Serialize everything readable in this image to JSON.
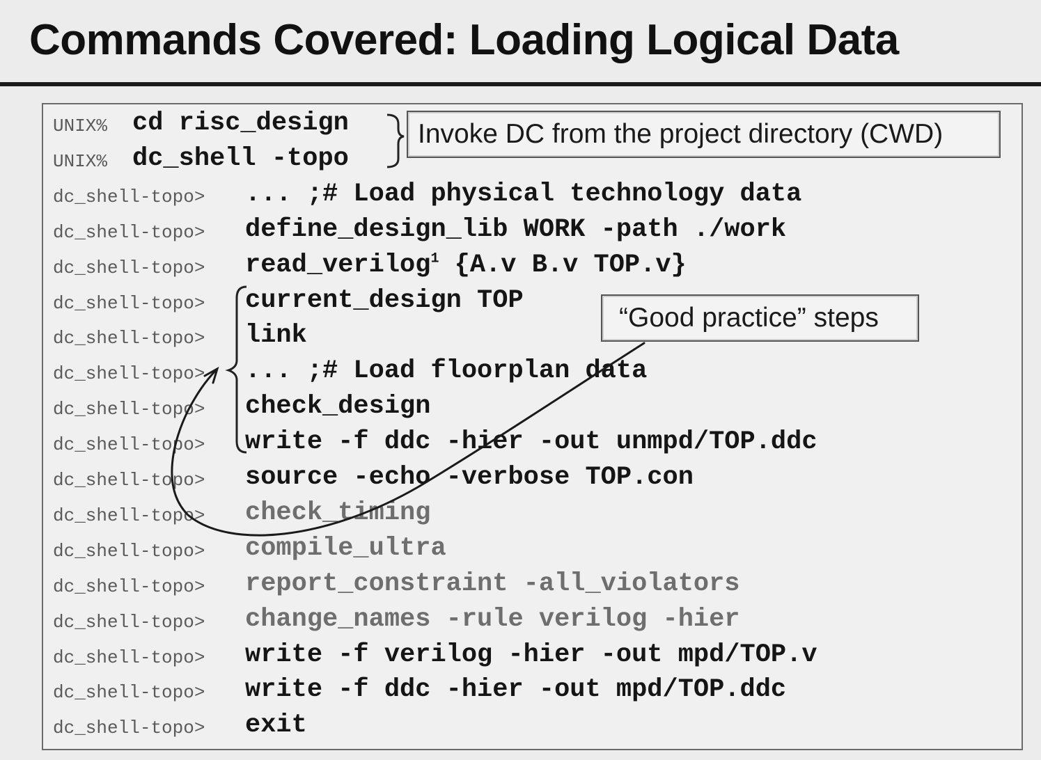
{
  "title": "Commands Covered: Loading Logical Data",
  "callouts": {
    "invoke": "Invoke DC from the project directory (CWD)",
    "good_practice": "“Good practice” steps"
  },
  "lines": [
    {
      "prompt": "UNIX%",
      "command": "cd risc_design",
      "style": "bold"
    },
    {
      "prompt": "UNIX%",
      "command": "dc_shell -topo",
      "style": "bold"
    },
    {
      "prompt": "dc_shell-topo>",
      "command": "... ;# Load physical technology data",
      "style": "bold"
    },
    {
      "prompt": "dc_shell-topo>",
      "command": "define_design_lib WORK -path ./work",
      "style": "bold"
    },
    {
      "prompt": "dc_shell-topo>",
      "command": "read_verilog",
      "superscript": "1",
      "command_tail": " {A.v B.v TOP.v}",
      "style": "bold"
    },
    {
      "prompt": "dc_shell-topo>",
      "command": "current_design TOP",
      "style": "bold"
    },
    {
      "prompt": "dc_shell-topo>",
      "command": "link",
      "style": "bold"
    },
    {
      "prompt": "dc_shell-topo>",
      "command": "... ;# Load floorplan data",
      "style": "bold"
    },
    {
      "prompt": "dc_shell-topo>",
      "command": "check_design",
      "style": "bold"
    },
    {
      "prompt": "dc_shell-topo>",
      "command": "write -f ddc -hier -out unmpd/TOP.ddc",
      "style": "bold"
    },
    {
      "prompt": "dc_shell-topo>",
      "command": "source -echo -verbose TOP.con",
      "style": "bold"
    },
    {
      "prompt": "dc_shell-topo>",
      "command": "check_timing",
      "style": "dim"
    },
    {
      "prompt": "dc_shell-topo>",
      "command": "compile_ultra",
      "style": "dim"
    },
    {
      "prompt": "dc_shell-topo>",
      "command": "report_constraint -all_violators",
      "style": "dim"
    },
    {
      "prompt": "dc_shell-topo>",
      "command": "change_names -rule verilog -hier",
      "style": "dim"
    },
    {
      "prompt": "dc_shell-topo>",
      "command": "write -f verilog -hier -out mpd/TOP.v",
      "style": "bold"
    },
    {
      "prompt": "dc_shell-topo>",
      "command": "write -f ddc -hier -out mpd/TOP.ddc",
      "style": "bold"
    },
    {
      "prompt": "dc_shell-topo>",
      "command": "exit",
      "style": "bold"
    }
  ],
  "colors": {
    "background": "#ececec",
    "text": "#151515",
    "prompt": "#5a5a5a",
    "dim_command": "#6e6e6e",
    "border": "#555555"
  }
}
